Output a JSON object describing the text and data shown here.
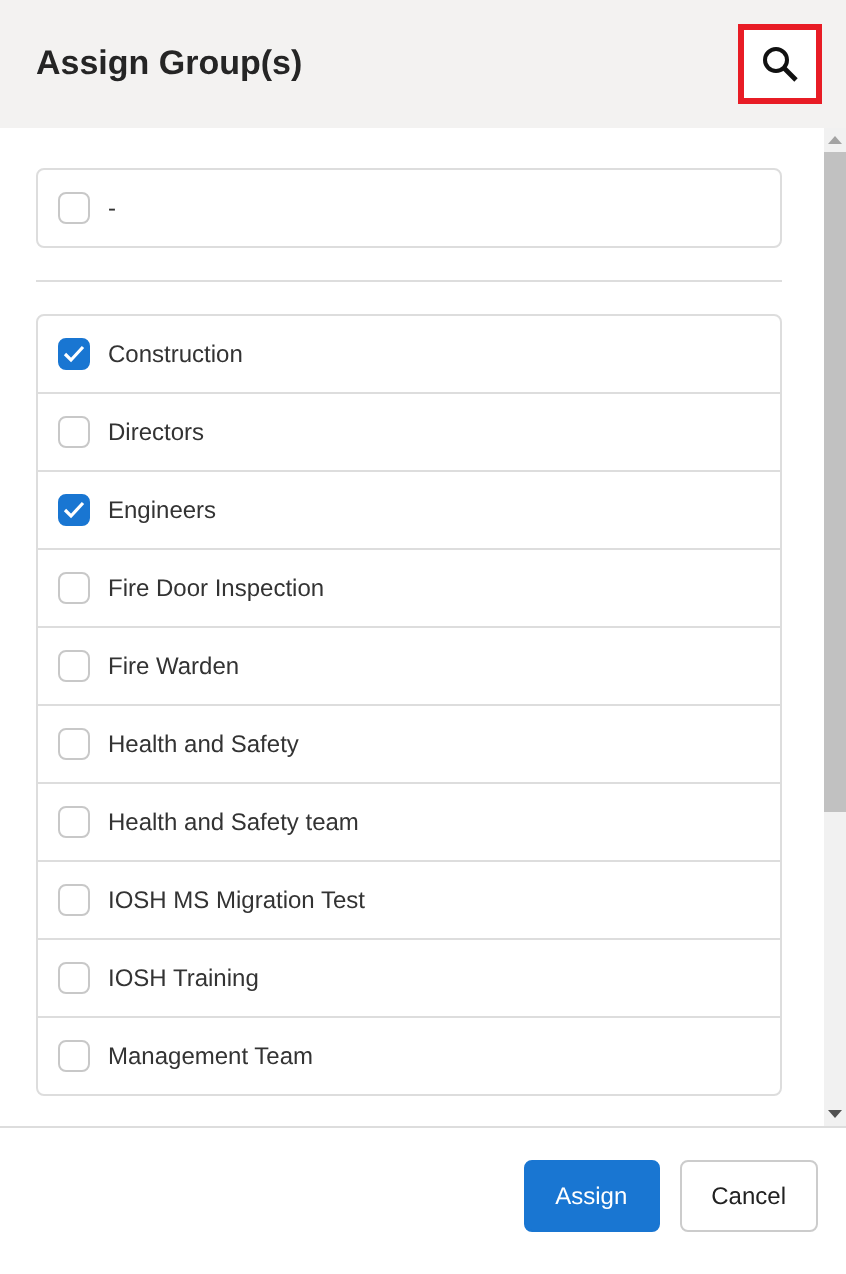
{
  "dialog": {
    "title": "Assign Group(s)"
  },
  "none_option": {
    "label": "-",
    "checked": false
  },
  "groups": [
    {
      "label": "Construction",
      "checked": true
    },
    {
      "label": "Directors",
      "checked": false
    },
    {
      "label": "Engineers",
      "checked": true
    },
    {
      "label": "Fire Door Inspection",
      "checked": false
    },
    {
      "label": "Fire Warden",
      "checked": false
    },
    {
      "label": "Health and Safety",
      "checked": false
    },
    {
      "label": "Health and Safety team",
      "checked": false
    },
    {
      "label": "IOSH MS Migration Test",
      "checked": false
    },
    {
      "label": "IOSH Training",
      "checked": false
    },
    {
      "label": "Management Team",
      "checked": false
    }
  ],
  "buttons": [
    {
      "label": "Assign",
      "kind": "primary"
    },
    {
      "label": "Cancel",
      "kind": "secondary"
    }
  ]
}
